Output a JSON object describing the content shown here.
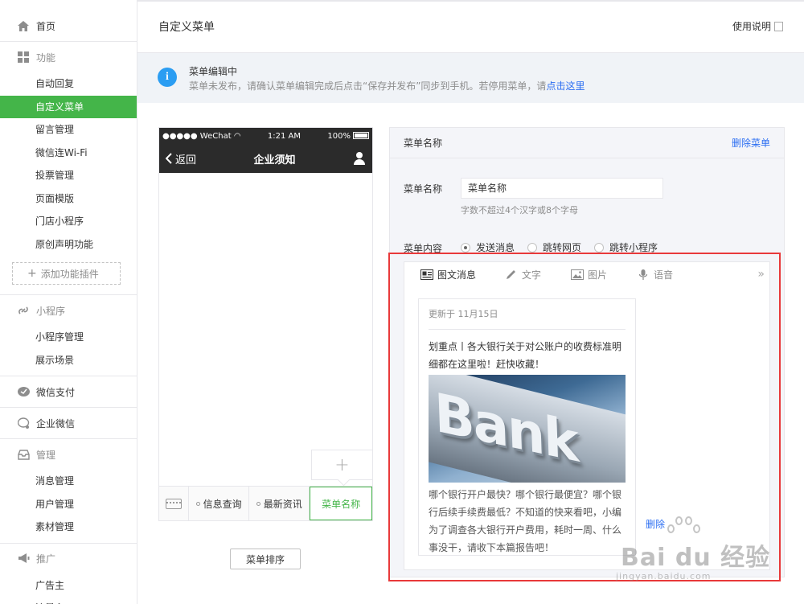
{
  "sidebar": {
    "home": "首页",
    "groups": [
      {
        "title": "功能",
        "icon": "grid-icon",
        "items": [
          "自动回复",
          "自定义菜单",
          "留言管理",
          "微信连Wi-Fi",
          "投票管理",
          "页面模版",
          "门店小程序",
          "原创声明功能"
        ],
        "active": "自定义菜单",
        "add_plugin": "添加功能插件"
      },
      {
        "title": "小程序",
        "icon": "link-icon",
        "items": [
          "小程序管理",
          "展示场景"
        ]
      },
      {
        "title": "微信支付",
        "icon": "wechat-pay-icon",
        "items": []
      },
      {
        "title": "企业微信",
        "icon": "chat-icon",
        "items": []
      },
      {
        "title": "管理",
        "icon": "inbox-icon",
        "items": [
          "消息管理",
          "用户管理",
          "素材管理"
        ]
      },
      {
        "title": "推广",
        "icon": "megaphone-icon",
        "items": [
          "广告主",
          "流量主"
        ]
      }
    ]
  },
  "header": {
    "title": "自定义菜单",
    "help": "使用说明"
  },
  "notice": {
    "title": "菜单编辑中",
    "text": "菜单未发布，请确认菜单编辑完成后点击“保存并发布”同步到手机。若停用菜单，请",
    "link": "点击这里"
  },
  "phone": {
    "carrier": "●●●●● WeChat",
    "time": "1:21 AM",
    "battery": "100%",
    "back": "返回",
    "title": "企业须知",
    "menu": [
      "信息查询",
      "最新资讯",
      "菜单名称"
    ],
    "sort_button": "菜单排序"
  },
  "editor": {
    "header": "菜单名称",
    "delete": "删除菜单",
    "name_label": "菜单名称",
    "name_value": "菜单名称",
    "name_hint": "字数不超过4个汉字或8个字母",
    "content_label": "菜单内容",
    "content_options": [
      "发送消息",
      "跳转网页",
      "跳转小程序"
    ],
    "content_selected": "发送消息",
    "tabs": [
      "图文消息",
      "文字",
      "图片",
      "语音"
    ],
    "article": {
      "date": "更新于 11月15日",
      "title": "划重点丨各大银行关于对公账户的收费标准明细都在这里啦！赶快收藏！",
      "image_text": "Bank",
      "desc": "哪个银行开户最快？哪个银行最便宜？哪个银行后续手续费最低？不知道的快来看吧，小编为了调查各大银行开户费用，耗时一周、什么事没干，请收下本篇报告吧！"
    },
    "link_partial": "删除"
  },
  "watermark": {
    "brand": "Bai du 经验",
    "url": "jingyan.baidu.com"
  },
  "colors": {
    "active_green": "#44b549",
    "link_blue": "#2b6ef2",
    "highlight_red": "#e8393a",
    "info_blue": "#2b9df2"
  }
}
